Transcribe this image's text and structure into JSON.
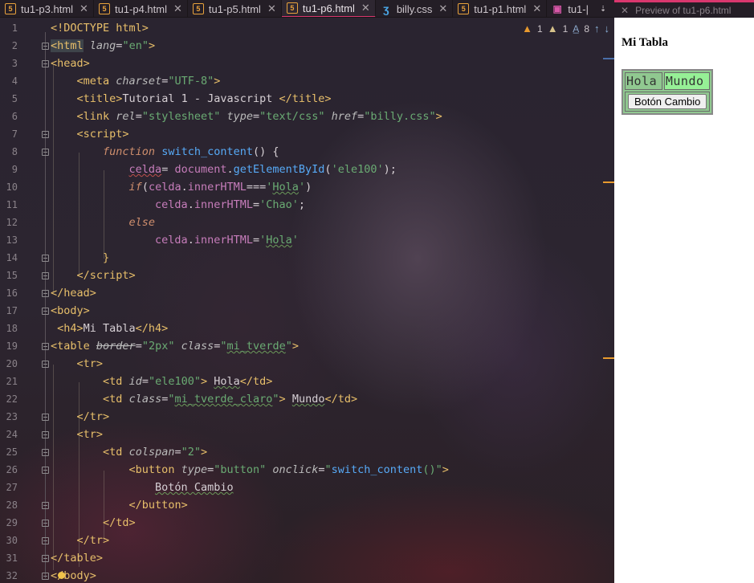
{
  "tabs": [
    {
      "label": "tu1-p3.html",
      "icon": "html-file-icon",
      "active": false
    },
    {
      "label": "tu1-p4.html",
      "icon": "html-file-icon",
      "active": false
    },
    {
      "label": "tu1-p5.html",
      "icon": "html-file-icon",
      "active": false
    },
    {
      "label": "tu1-p6.html",
      "icon": "html-file-icon",
      "active": true
    },
    {
      "label": "billy.css",
      "icon": "css-file-icon",
      "active": false
    },
    {
      "label": "tu1-p1.html",
      "icon": "html-file-icon",
      "active": false
    },
    {
      "label": "tu1-|",
      "icon": "image-file-icon",
      "active": false
    }
  ],
  "preview_tab": {
    "label": "Preview of tu1-p6.html"
  },
  "inspections": {
    "warnings": "1",
    "weak_warnings": "1",
    "typos": "8"
  },
  "line_numbers": [
    "1",
    "2",
    "3",
    "4",
    "5",
    "6",
    "7",
    "8",
    "9",
    "10",
    "11",
    "12",
    "13",
    "14",
    "15",
    "16",
    "17",
    "18",
    "19",
    "20",
    "21",
    "22",
    "23",
    "24",
    "25",
    "26",
    "27",
    "28",
    "29",
    "30",
    "31",
    "32"
  ],
  "code": {
    "l1": "<!DOCTYPE html>",
    "l5_text": "Tutorial 1 - Javascript ",
    "l18_text": "Mi Tabla",
    "l22_text": "Hola",
    "l23_text": "Mundo",
    "l27_text": "Botón Cambio"
  },
  "preview": {
    "heading": "Mi Tabla",
    "cell1": "Hola",
    "cell2": "Mundo",
    "button": "Botón Cambio"
  },
  "colors": {
    "accent": "#d9376e",
    "tag": "#e8bf6a",
    "string": "#6aab73",
    "function": "#57aaf7",
    "keyword": "#cf8e6d"
  }
}
